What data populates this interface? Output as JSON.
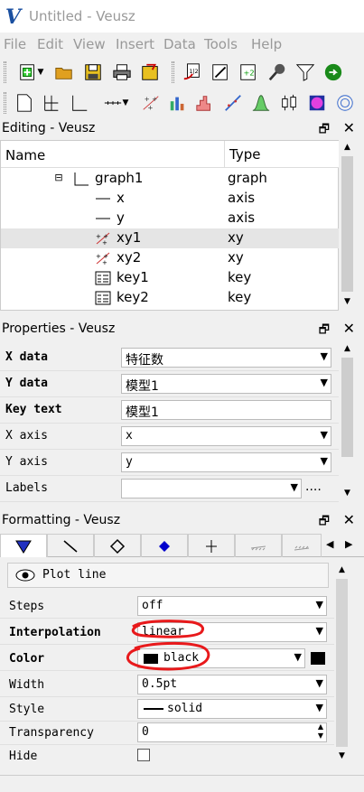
{
  "window": {
    "title": "Untitled - Veusz",
    "logo": "V"
  },
  "menu": [
    "File",
    "Edit",
    "View",
    "Insert",
    "Data",
    "Tools",
    "Help"
  ],
  "toolbar1": [
    "new-document-icon",
    "open-folder-icon",
    "save-icon",
    "print-icon",
    "export-icon",
    "import-data-icon",
    "edit-data-icon",
    "create-dataset-icon",
    "capture-data-icon",
    "filter-icon",
    "reload-icon"
  ],
  "toolbar2": [
    "new-page-icon",
    "grid-icon",
    "axes-graph-icon",
    "axis-icon",
    "xy-plot-icon",
    "bar-chart-icon",
    "histogram-icon",
    "fit-icon",
    "function-icon",
    "boxplot-icon",
    "image-icon",
    "polar-icon"
  ],
  "editing": {
    "title": "Editing - Veusz",
    "col_name": "Name",
    "col_type": "Type",
    "rows": [
      {
        "name": "graph1",
        "type": "graph"
      },
      {
        "name": "x",
        "type": "axis"
      },
      {
        "name": "y",
        "type": "axis"
      },
      {
        "name": "xy1",
        "type": "xy"
      },
      {
        "name": "xy2",
        "type": "xy"
      },
      {
        "name": "key1",
        "type": "key"
      },
      {
        "name": "key2",
        "type": "key"
      }
    ],
    "expander": "⊟"
  },
  "properties": {
    "title": "Properties - Veusz",
    "rows": [
      {
        "label": "X data",
        "value": "特征数",
        "bold": true
      },
      {
        "label": "Y data",
        "value": "模型1",
        "bold": true
      },
      {
        "label": "Key text",
        "value": "模型1",
        "bold": true
      },
      {
        "label": "X axis",
        "value": "x",
        "bold": false
      },
      {
        "label": "Y axis",
        "value": "y",
        "bold": false
      },
      {
        "label": "Labels",
        "value": "",
        "bold": false
      }
    ],
    "ellipsis": "...."
  },
  "formatting": {
    "title": "Formatting - Veusz",
    "section": "Plot line",
    "rows": [
      {
        "label": "Steps",
        "value": "off"
      },
      {
        "label": "Interpolation",
        "value": "linear"
      },
      {
        "label": "Color",
        "value": "black"
      },
      {
        "label": "Width",
        "value": "0.5pt"
      },
      {
        "label": "Style",
        "value": "solid"
      },
      {
        "label": "Transparency",
        "value": "0"
      },
      {
        "label": "Hide",
        "value": ""
      }
    ]
  },
  "glyphs": {
    "float": "🗗",
    "close": "✕",
    "arrow": "▼",
    "up": "▲",
    "down": "▼",
    "left": "◀",
    "right": "▶",
    "eye": "👁"
  },
  "colors": {
    "accent": "#1a4fa0",
    "annotation": "#e8191b",
    "selected_row": "#e5e5e5"
  }
}
